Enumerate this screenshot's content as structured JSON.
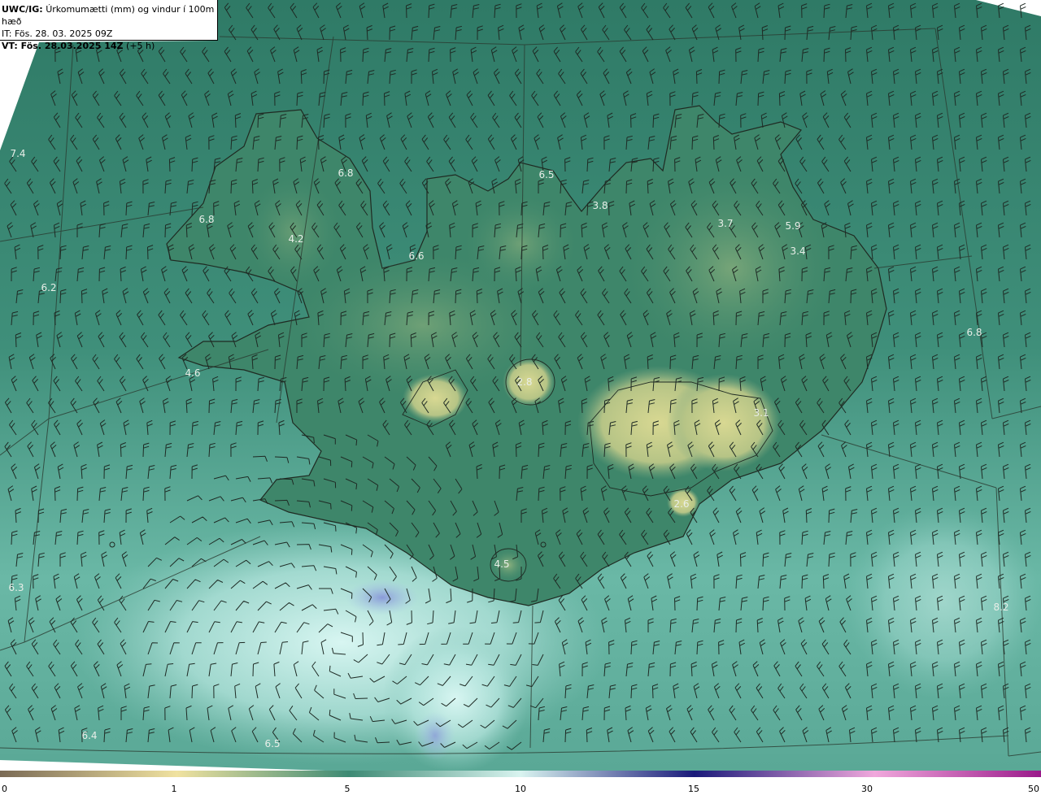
{
  "header": {
    "model": "UWC/IG:",
    "title": "Úrkomumætti (mm) og vindur í 100m hæð",
    "initial_time": "IT: Fös. 28. 03. 2025 09Z",
    "valid_prefix": "VT: Fös. 28.03.2025 14Z",
    "valid_offset": "(+5 h)"
  },
  "value_labels": [
    {
      "text": "7.4"
    },
    {
      "text": "6.8"
    },
    {
      "text": "6.8"
    },
    {
      "text": "4.2"
    },
    {
      "text": "6.6"
    },
    {
      "text": "6.5"
    },
    {
      "text": "3.8"
    },
    {
      "text": "3.7"
    },
    {
      "text": "5.9"
    },
    {
      "text": "3.4"
    },
    {
      "text": "6.2"
    },
    {
      "text": "6.8"
    },
    {
      "text": "4.6"
    },
    {
      "text": "2.8"
    },
    {
      "text": "3.1"
    },
    {
      "text": "2.6"
    },
    {
      "text": "4.5"
    },
    {
      "text": "6.3"
    },
    {
      "text": "8.2"
    },
    {
      "text": "6.4"
    },
    {
      "text": "6.5"
    }
  ],
  "colorbar": {
    "ticks": [
      "0",
      "1",
      "5",
      "10",
      "15",
      "30",
      "50"
    ],
    "colors": {
      "low": "#7a6a55",
      "mid_low": "#f0e2a0",
      "mid": "#3d8a74",
      "mid_high": "#d9f4f0",
      "high_blue": "#1a1a7a",
      "high_pink": "#f0a8dc",
      "top": "#9a1a8a"
    }
  },
  "map_colors": {
    "ocean": "#4f9a88",
    "land": "#3f8a6a",
    "highland": "#c8cf8a",
    "south_light": "#c2ece6",
    "blue_spot": "#8a9bd6"
  }
}
